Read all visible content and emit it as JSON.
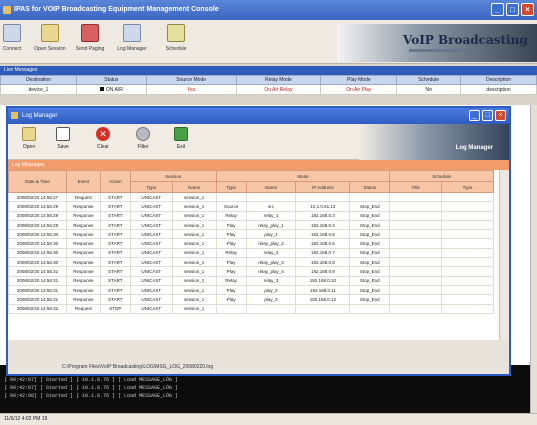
{
  "main_window": {
    "title": "IPAS for VOIP Broadcasting Equipment Management Console",
    "buttons": {
      "minimize": "_",
      "maximize": "□",
      "close": "×"
    },
    "toolbar": [
      {
        "label": "Connect",
        "icon": "connect-icon"
      },
      {
        "label": "Open Session",
        "icon": "folder-icon"
      },
      {
        "label": "Send Paging",
        "icon": "paging-icon"
      },
      {
        "label": "Log Manager",
        "icon": "log-icon"
      },
      {
        "label": "Schedule",
        "icon": "schedule-icon"
      }
    ],
    "brand_title": "VoIP Broadcasting",
    "section_title": "Live Messages",
    "columns": [
      "Destination",
      "Status",
      "Source Mode",
      "Relay Mode",
      "Play Mode",
      "Schedule",
      "Description"
    ],
    "rows": [
      [
        "device_1",
        "ON AIR",
        "Yes",
        "On Air Relay",
        "On Air Play",
        "No",
        "description"
      ]
    ],
    "console_lines": [
      "[ 09:42:07] [ Started ]    [ 10.1.0.76 ]    [ Load MESSAGE_LOG ]",
      "[ 09:42:07] [ Started ]    [ 10.1.0.76 ]    [ Load MESSAGE_LOG ]",
      "[ 09:42:08] [ Started ]    [ 10.1.0.76 ]    [ Load MESSAGE_LOG ]"
    ],
    "status_text": "11/6/12 4:02 PM 19"
  },
  "log_dialog": {
    "title": "Log Manager",
    "toolbar": [
      {
        "label": "Open",
        "icon": "folder-open-icon"
      },
      {
        "label": "Save",
        "icon": "document-icon"
      },
      {
        "label": "Clear",
        "icon": "clear-icon"
      },
      {
        "label": "Filter",
        "icon": "filter-icon"
      },
      {
        "label": "Exit",
        "icon": "exit-icon"
      }
    ],
    "brand_title": "Log Manager",
    "section_title": "Log Messages",
    "group_headers": {
      "session": "Session",
      "mode": "Mode",
      "schedule": "Schedule"
    },
    "columns": [
      "Date & Time",
      "Event",
      "Action",
      "Type",
      "Name",
      "Type",
      "Name",
      "IP Address",
      "Status",
      "Title",
      "Type"
    ],
    "rows": [
      [
        "2008/02/20 14:56:27",
        "Request",
        "START",
        "UNICAST",
        "session_1",
        "",
        "",
        "",
        "",
        "",
        ""
      ],
      [
        "2008/02/20 14:56:29",
        "Response",
        "START",
        "UNICAST",
        "session_1",
        "Source",
        "src",
        "10.1.0.61:13",
        "Stop_End",
        "",
        ""
      ],
      [
        "2008/02/20 14:56:29",
        "Response",
        "START",
        "UNICAST",
        "session_1",
        "Relay",
        "relay_1",
        "192.168.0.3",
        "Stop_End",
        "",
        ""
      ],
      [
        "2008/02/20 14:56:29",
        "Response",
        "START",
        "UNICAST",
        "session_1",
        "Play",
        "relay_play_1",
        "192.168.0.4",
        "Stop_End",
        "",
        ""
      ],
      [
        "2008/02/20 14:56:30",
        "Response",
        "START",
        "UNICAST",
        "session_1",
        "Play",
        "play_1",
        "192.168.0.5",
        "Stop_End",
        "",
        ""
      ],
      [
        "2008/02/20 14:56:30",
        "Response",
        "START",
        "UNICAST",
        "session_1",
        "Play",
        "relay_play_2",
        "192.168.0.6",
        "Stop_End",
        "",
        ""
      ],
      [
        "2008/02/20 14:56:30",
        "Response",
        "START",
        "UNICAST",
        "session_1",
        "Relay",
        "relay_2",
        "192.168.0.7",
        "Stop_End",
        "",
        ""
      ],
      [
        "2008/02/20 14:56:30",
        "Response",
        "START",
        "UNICAST",
        "session_1",
        "Play",
        "relay_play_3",
        "192.168.0.8",
        "Stop_End",
        "",
        ""
      ],
      [
        "2008/02/20 14:56:31",
        "Response",
        "START",
        "UNICAST",
        "session_1",
        "Play",
        "relay_play_4",
        "192.168.0.9",
        "Stop_End",
        "",
        ""
      ],
      [
        "2008/02/20 14:56:31",
        "Response",
        "START",
        "UNICAST",
        "session_1",
        "Relay",
        "relay_3",
        "192.168.0.10",
        "Stop_End",
        "",
        ""
      ],
      [
        "2008/02/20 14:56:31",
        "Response",
        "START",
        "UNICAST",
        "session_1",
        "Play",
        "play_2",
        "192.168.0.11",
        "Stop_End",
        "",
        ""
      ],
      [
        "2008/02/20 14:56:31",
        "Response",
        "START",
        "UNICAST",
        "session_1",
        "Play",
        "play_3",
        "192.168.0.12",
        "Stop_End",
        "",
        ""
      ],
      [
        "2008/02/20 14:56:32",
        "Request",
        "STOP",
        "UNICAST",
        "session_1",
        "",
        "",
        "",
        "",
        "",
        ""
      ]
    ],
    "file_path": "C:\\Program Files\\VoIP Broadcasting\\LOG\\MSG_LOG_20080220.log"
  }
}
